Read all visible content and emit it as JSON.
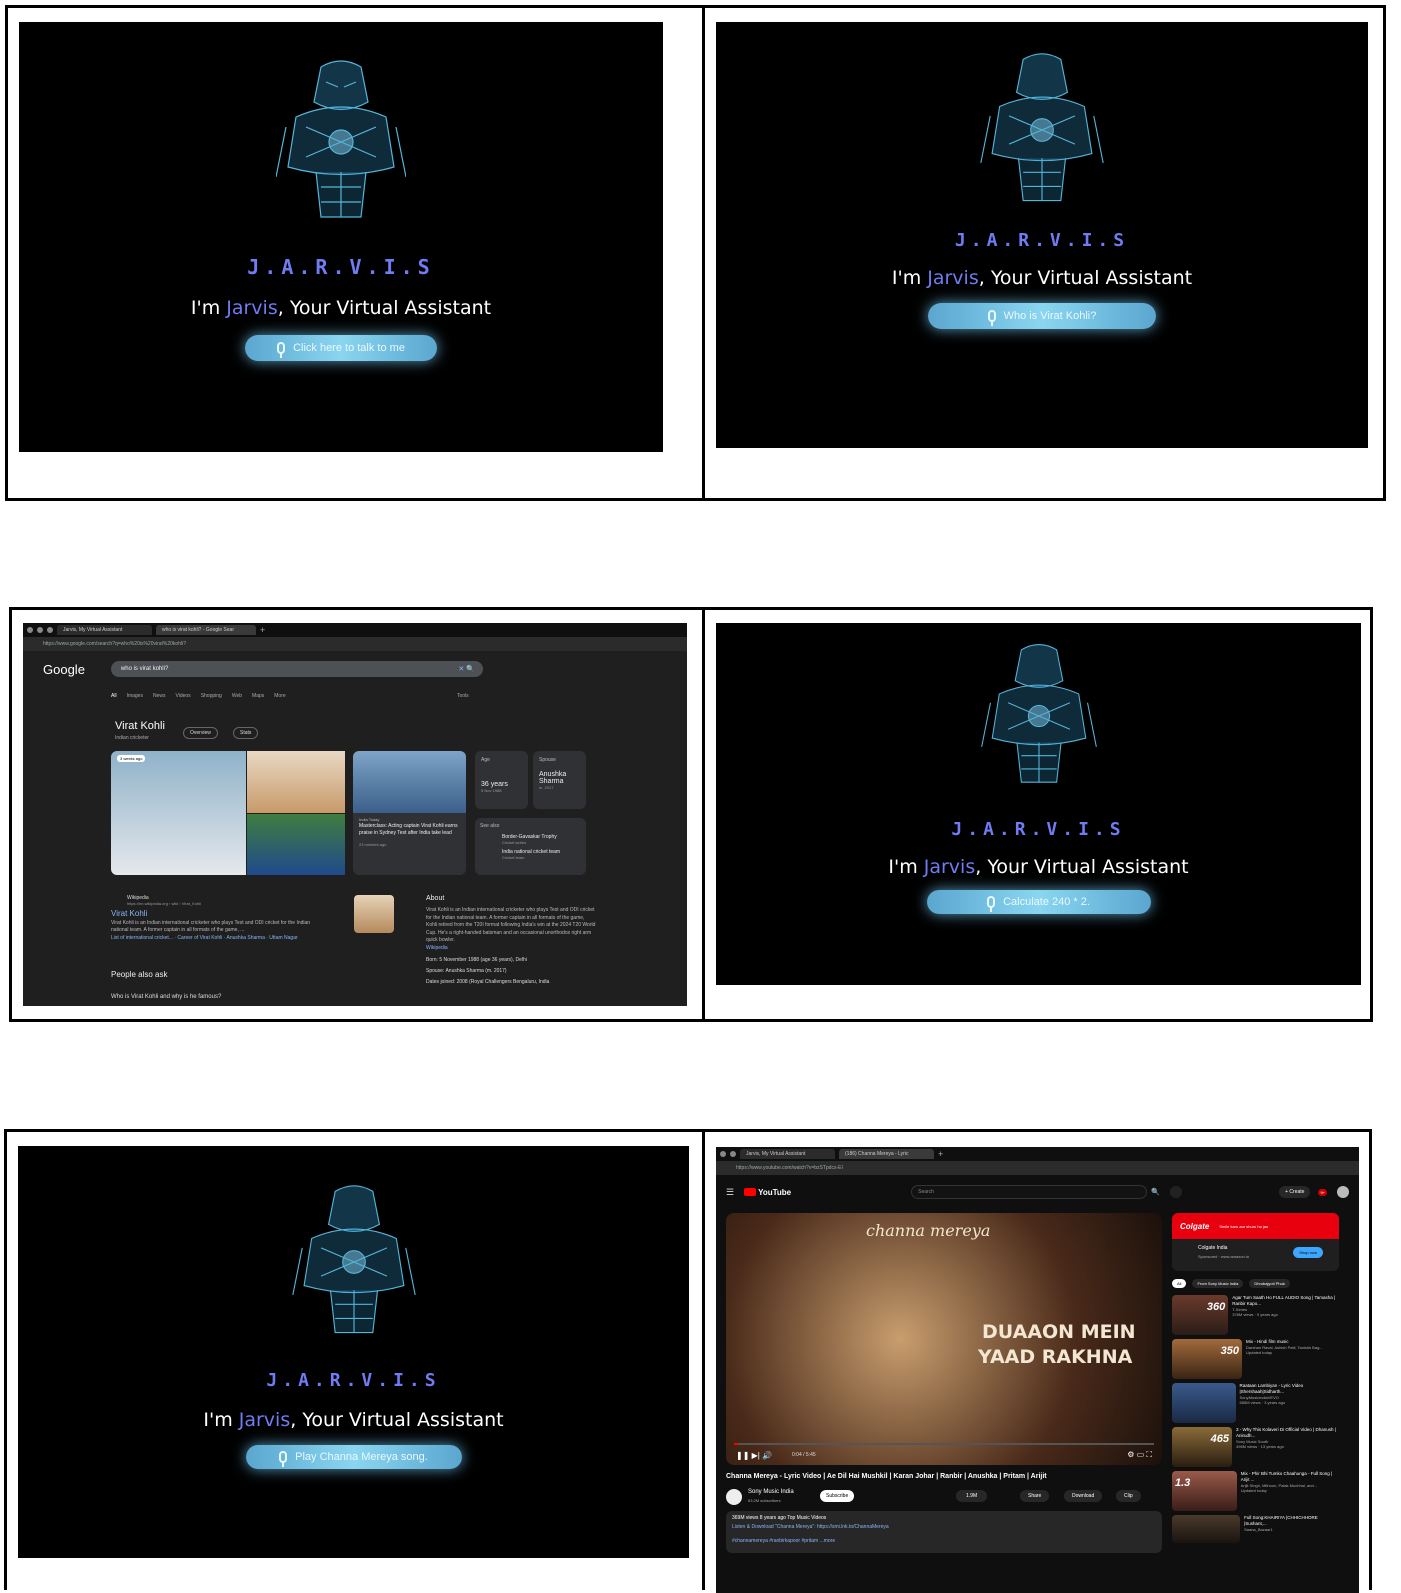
{
  "jarvis": {
    "title": "J.A.R.V.I.S",
    "tagline_pre": "I'm ",
    "tagline_hl": "Jarvis",
    "tagline_post": ", Your Virtual Assistant",
    "btn1": "Click here to talk to me",
    "btn2": "Who is Virat Kohli?",
    "btn3": "Calculate 240 * 2.",
    "btn4": "Play Channa Mereya song."
  },
  "colors": {
    "accent": "#6f7cf2",
    "glow": "#8ad6f0"
  },
  "google": {
    "tab1": "Jarvis, My Virtual Assistant",
    "tab2": "who is virat kohli? - Google Sear",
    "url": "https://www.google.com/search?q=who%20is%20virat%20kohli?",
    "logo": "Google",
    "query": "who is virat kohli?",
    "nav": [
      "All",
      "Images",
      "News",
      "Videos",
      "Shopping",
      "Web",
      "Maps",
      "More"
    ],
    "tools": "Tools",
    "name": "Virat Kohli",
    "subtitle": "Indian cricketer",
    "chip_overview": "Overview",
    "chip_stats": "Stats",
    "age_label": "Age",
    "age_value": "36 years",
    "age_date": "5 Nov 1988",
    "spouse_label": "Spouse",
    "spouse_value": "Anushka Sharma",
    "spouse_date": "m. 2017",
    "news_source": "India Today",
    "news_text": "Masterclass: Acting captain Virat Kohli earns praise in Sydney Test after India take lead",
    "news_time": "23 minutes ago",
    "weeks_ago": "3 weeks ago",
    "see_also": "See also",
    "bgt": "Border-Gavaskar Trophy",
    "bgt_sub": "Cricket series",
    "ict": "India national cricket team",
    "ict_sub": "Cricket team",
    "wiki_source": "Wikipedia",
    "wiki_url": "https://en.wikipedia.org › wiki › Virat_Kohli",
    "wiki_title": "Virat Kohli",
    "wiki_text": "Virat Kohli is an Indian international cricketer who plays Test and ODI cricket for the Indian national team. A former captain in all formats of the game, ...",
    "wiki_links": "List of international cricket... · Career of Virat Kohli · Anushka Sharma · Uttam Nagar",
    "about": "About",
    "about_text": "Virat Kohli is an Indian international cricketer who plays Test and ODI cricket for the Indian national team. A former captain in all formats of the game, Kohli retired from the T20I format following India's win at the 2024 T20 World Cup. He's a right-handed batsman and an occasional unorthodox right arm quick bowler.",
    "about_link": "Wikipedia",
    "born": "Born: 5 November 1988 (age 36 years), Delhi",
    "spouse_line": "Spouse: Anushka Sharma (m. 2017)",
    "dates_joined": "Dates joined: 2008 (Royal Challengers Bengaluru, India",
    "paa": "People also ask",
    "paa_q": "Who is Virat Kohli and why is he famous?"
  },
  "youtube": {
    "tab1": "Jarvis, My Virtual Assistant",
    "tab2": "(186) Channa Mereya - Lyric",
    "url": "https://www.youtube.com/watch?v=bzSTpdcs-EI",
    "logo": "YouTube",
    "search": "Search",
    "create": "+ Create",
    "notif": "9+",
    "video_script": "channa mereya",
    "overlay1": "DUAAON MEIN",
    "overlay2": "YAAD RAKHNA",
    "time": "0:04 / 5:45",
    "video_title": "Channa Mereya - Lyric Video | Ae Dil Hai Mushkil | Karan Johar | Ranbir | Anushka | Pritam | Arijit",
    "channel": "Sony Music India",
    "subs": "63.2M subscribers",
    "subscribe": "Subscribe",
    "likes": "1.9M",
    "share": "Share",
    "download": "Download",
    "clip": "Clip",
    "views": "369M views  8 years ago  Top Music Videos",
    "desc": "Listen & Download \"Channa Mereya\": https://smi.lnk.to/ChannaMereya",
    "tags": "#channamereya #ranbirkapoor #pritam  ...more",
    "ad_brand": "Colgate",
    "ad_tag": "Smile karo aur shuru ho jao",
    "ad_name": "Colgate India",
    "ad_sponsored": "Sponsored · www.amazon.in",
    "ad_btn": "Shop now",
    "filters": [
      "All",
      "From Sony Music India",
      "Dhrubajyoti Phuk"
    ],
    "recs": [
      {
        "t": "Agar Tum Saath Ho FULL AUDIO Song | Tamasha | Ranbir Kapo...",
        "c": "T-Series",
        "v": "378M views · 9 years ago",
        "b": "360"
      },
      {
        "t": "Mix - Hindi film music",
        "c": "Darshan Raval, Ashish Patil, Tanishk Bag...",
        "v": "Updated today",
        "b": "350"
      },
      {
        "t": "Raataan Lambiyan - Lyric Video |Shershaah|Sidharth...",
        "c": "SonyMusicIndiaVEVO",
        "v": "585M views · 3 years ago",
        "b": ""
      },
      {
        "t": "3 - Why This Kolaveri Di Official Video | Dhanush | Anirudh...",
        "c": "Sony Music South",
        "v": "496M views · 13 years ago",
        "b": "465"
      },
      {
        "t": "Mix - Phir Bhi Tumko Chaahunga - Full Song | Arijit ...",
        "c": "Arijit Singh, Mithoon, Palak Muchhal, and...",
        "v": "Updated today",
        "b": "1.3"
      },
      {
        "t": "Full Song:KHAIRIYA |CHHICHHORE |Sushant,...",
        "c": "Saana_Bazaar1",
        "v": "",
        "b": ""
      }
    ]
  }
}
